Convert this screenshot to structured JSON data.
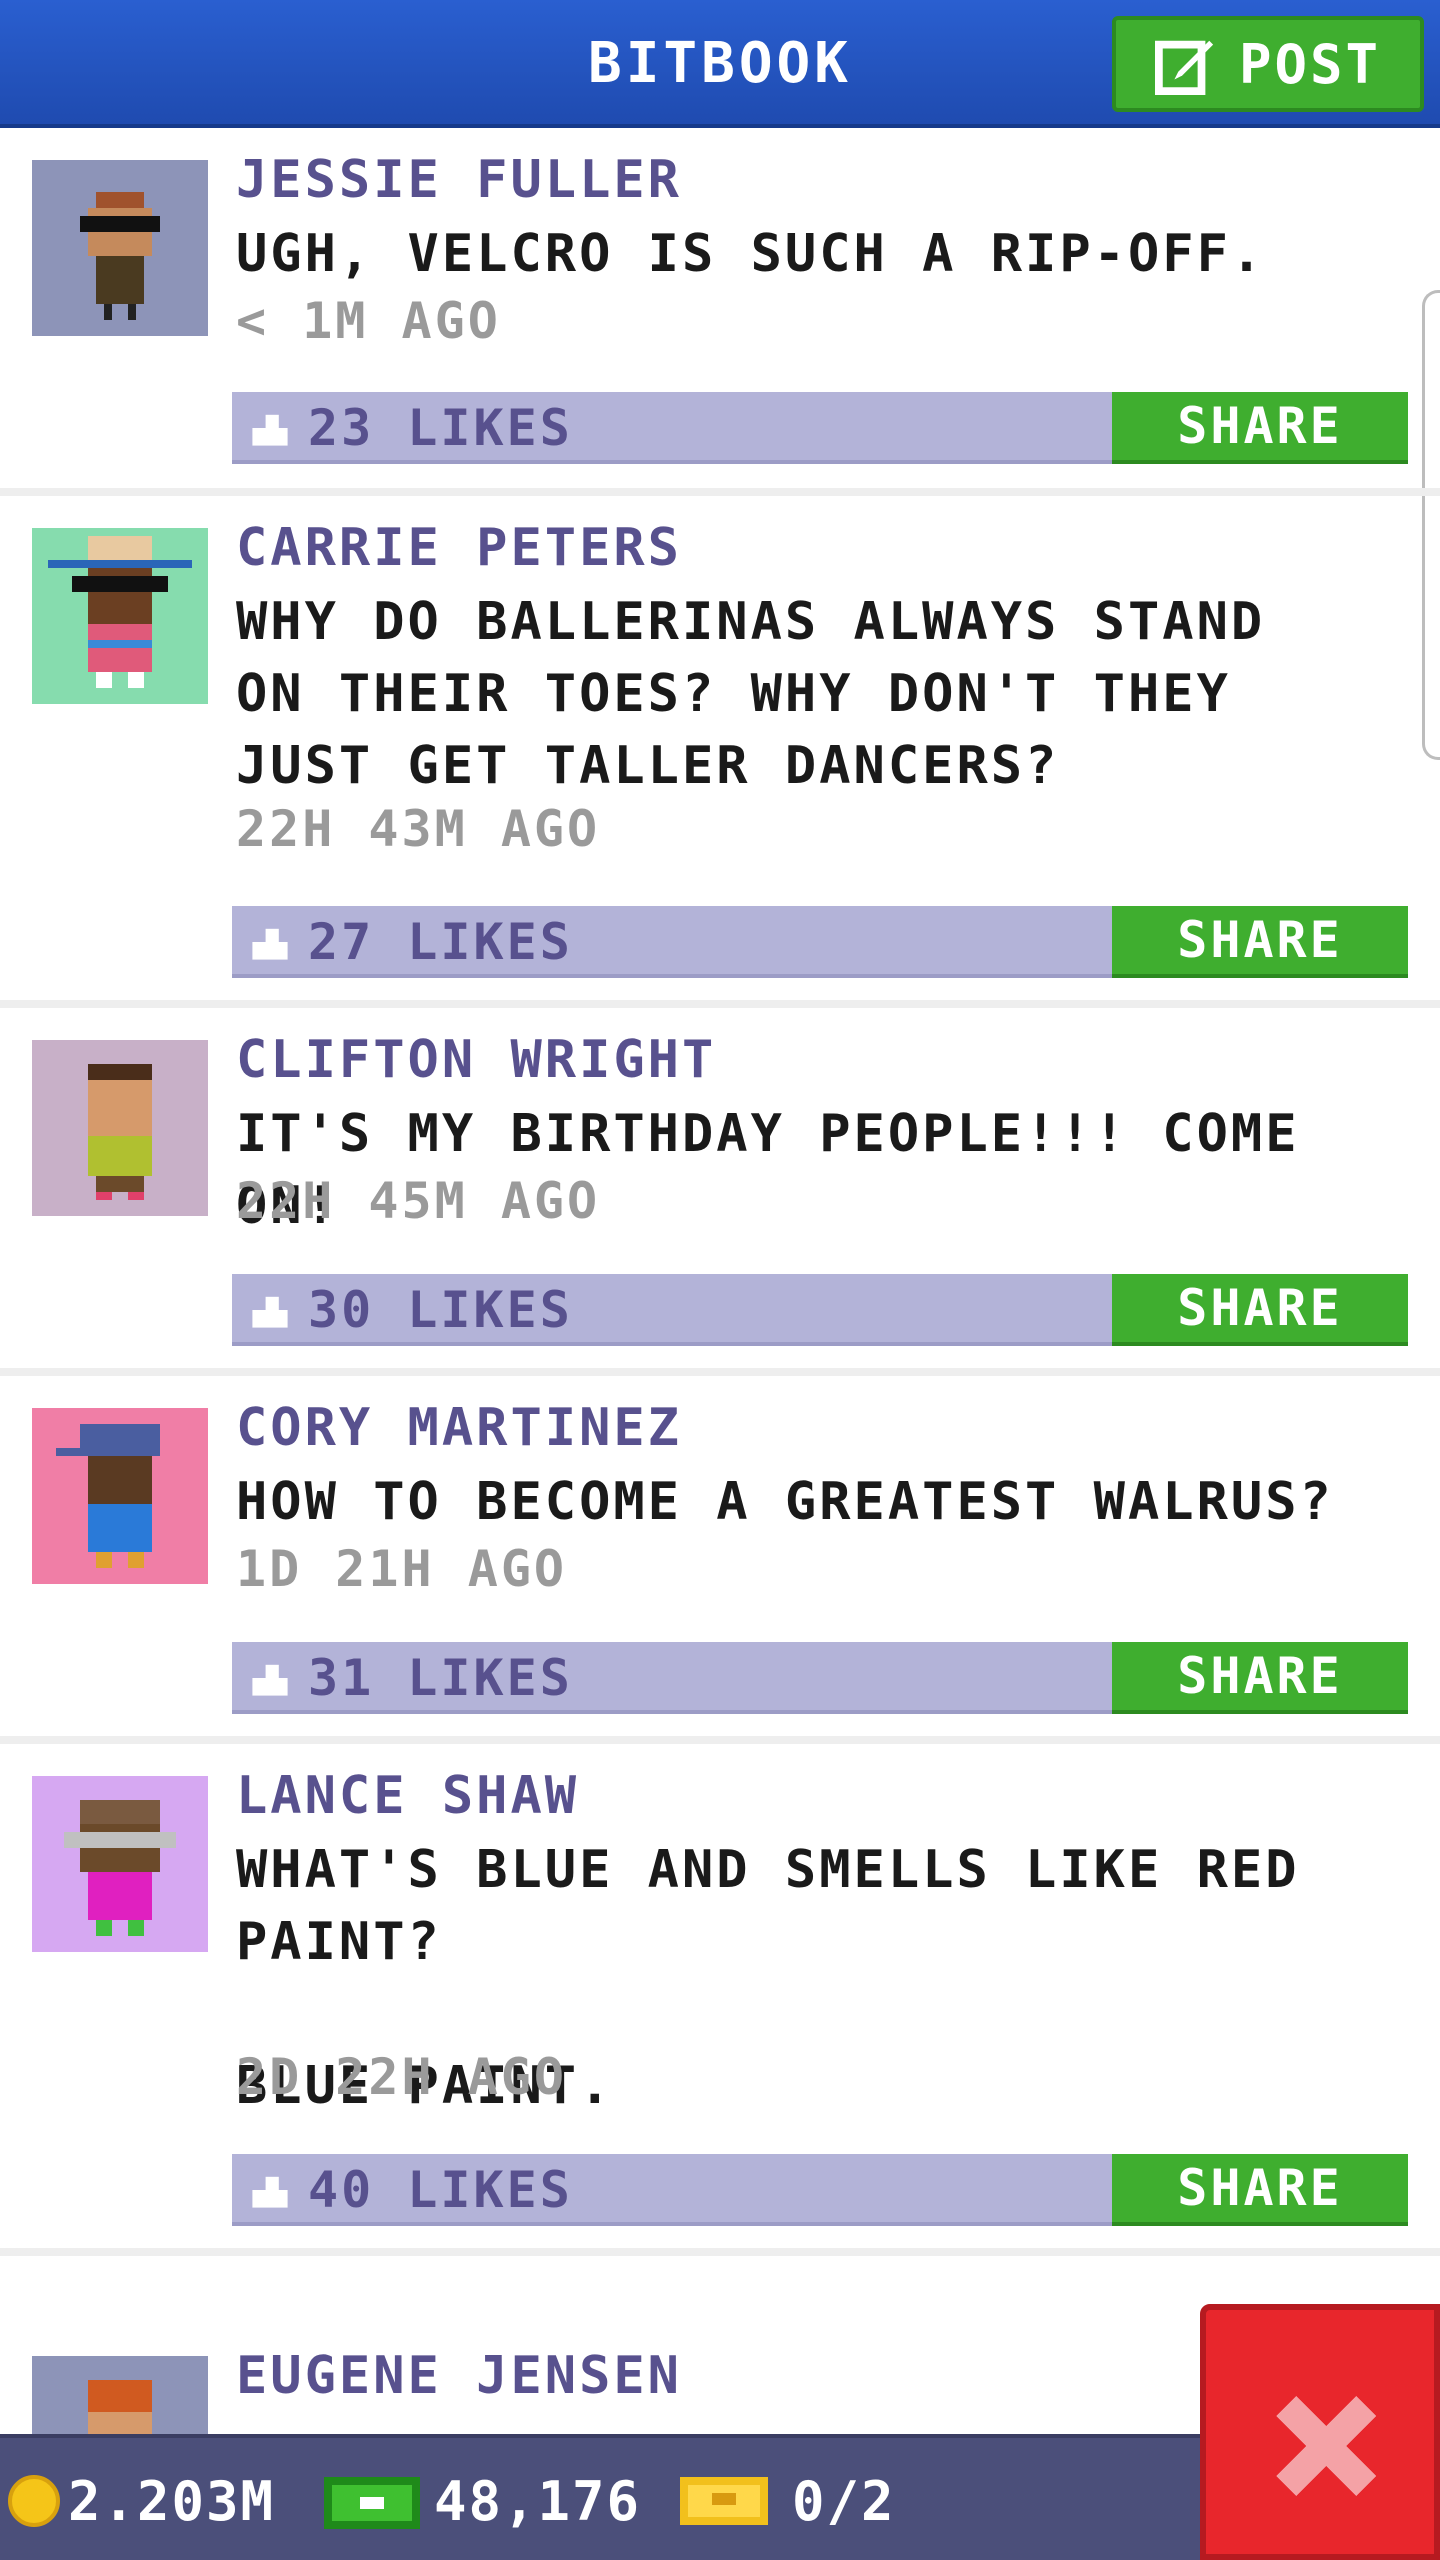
{
  "header": {
    "title": "BITBOOK",
    "post_label": "POST"
  },
  "posts": [
    {
      "name": "JESSIE FULLER",
      "message": "UGH, VELCRO IS SUCH A RIP-OFF.",
      "time": "< 1M AGO",
      "likes": "23 LIKES",
      "share": "SHARE",
      "avatar_bg": "#8d94b8"
    },
    {
      "name": "CARRIE PETERS",
      "message": "WHY DO BALLERINAS ALWAYS STAND\nON THEIR TOES? WHY DON'T THEY\nJUST GET TALLER DANCERS?",
      "time": "22H 43M AGO",
      "likes": "27 LIKES",
      "share": "SHARE",
      "avatar_bg": "#86dcae"
    },
    {
      "name": "CLIFTON WRIGHT",
      "message": "IT'S MY BIRTHDAY PEOPLE!!! COME ON!",
      "time": "22H 45M AGO",
      "likes": "30 LIKES",
      "share": "SHARE",
      "avatar_bg": "#c8b0c8"
    },
    {
      "name": "CORY MARTINEZ",
      "message": "HOW TO BECOME A GREATEST WALRUS?",
      "time": "1D 21H AGO",
      "likes": "31 LIKES",
      "share": "SHARE",
      "avatar_bg": "#f07ea6"
    },
    {
      "name": "LANCE SHAW",
      "message": "WHAT'S BLUE AND SMELLS LIKE RED\nPAINT?\n\nBLUE PAINT.",
      "time": "2D 22H AGO",
      "likes": "40 LIKES",
      "share": "SHARE",
      "avatar_bg": "#d6a8f2"
    },
    {
      "name": "EUGENE JENSEN",
      "avatar_bg": "#8d94b8"
    }
  ],
  "status": {
    "coins": "2.203M",
    "bux": "48,176",
    "tickets": "0/2"
  },
  "colors": {
    "header": "#1f4bb0",
    "accent_green": "#3fae2f",
    "likes_bar": "#b3b3d8",
    "close_red": "#e8262c"
  },
  "icons": {
    "post": "edit-icon",
    "like": "thumbs-up-icon",
    "close": "close-icon",
    "coin": "coin-icon",
    "bux": "bux-icon",
    "ticket": "ticket-icon"
  }
}
